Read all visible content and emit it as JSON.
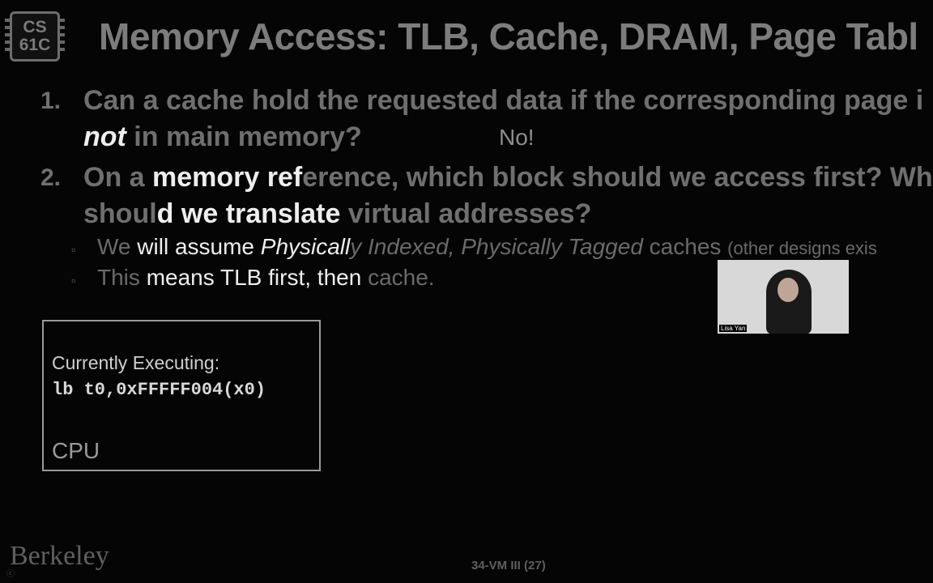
{
  "logo": {
    "line1": "CS",
    "line2": "61C"
  },
  "title": "Memory Access: TLB, Cache, DRAM, Page Tabl",
  "questions": [
    {
      "number": "1.",
      "line1": "Can a cache hold the requested data if the corresponding page i",
      "line2_emph": "not",
      "line2_rest": " in main memory?",
      "answer": "No!"
    },
    {
      "number": "2.",
      "line1_a": "On a ",
      "line1_b": "memory ref",
      "line1_c": "erence, which block should we access first? Whe",
      "line2_a": "shoul",
      "line2_b": "d we translate",
      "line2_c": " virtual addresses?"
    }
  ],
  "bullets": [
    {
      "a": "We ",
      "b": "will assume ",
      "c_em": "Physicall",
      "d_em": "y Indexed, Physically Tagged",
      "e": " caches ",
      "f": "(other designs exis"
    },
    {
      "a": "This ",
      "b": "means TLB first, then ",
      "c": "cache."
    }
  ],
  "cpu": {
    "executing_label": "Currently Executing:",
    "instruction": "lb t0,0xFFFFF004(x0)",
    "name": "CPU"
  },
  "video": {
    "name": "Lisa Yan"
  },
  "footer": {
    "institution": "Berkeley",
    "slide": "34-VM III (27)"
  }
}
